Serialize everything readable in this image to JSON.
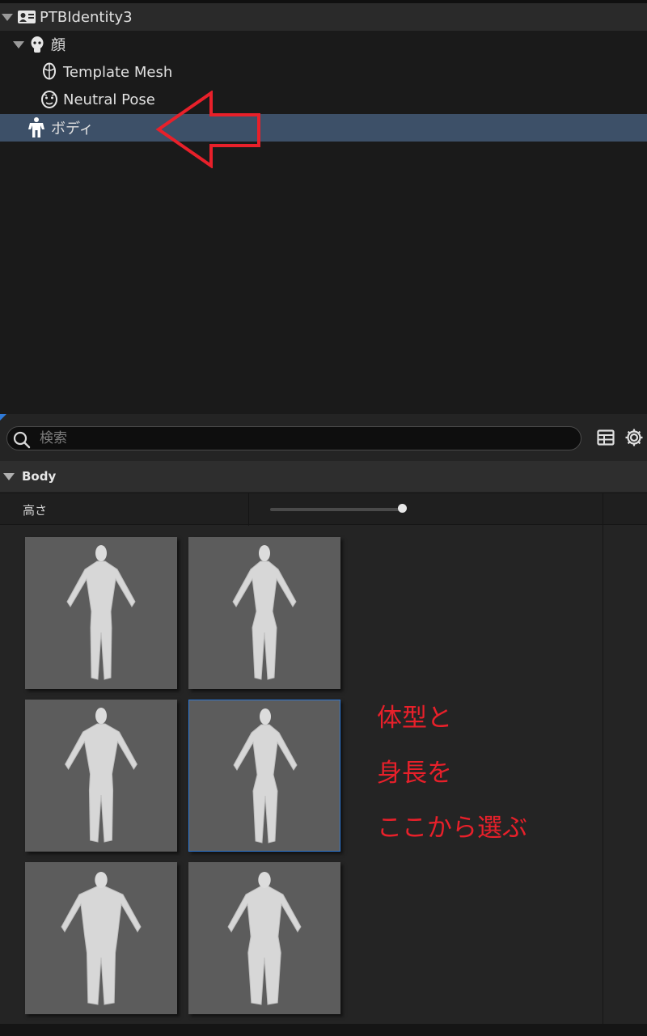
{
  "outliner": {
    "root": {
      "label": "PTBIdentity3",
      "icon": "identity-icon"
    },
    "face": {
      "label": "顔",
      "icon": "head-icon"
    },
    "template_mesh": {
      "label": "Template Mesh",
      "icon": "mesh-head-icon"
    },
    "neutral_pose": {
      "label": "Neutral Pose",
      "icon": "face-pose-icon"
    },
    "body": {
      "label": "ボディ",
      "icon": "body-icon",
      "selected": true
    }
  },
  "details": {
    "search": {
      "placeholder": "検索",
      "value": ""
    },
    "category": {
      "label": "Body"
    },
    "property": {
      "label": "高さ",
      "slider_value": 1.0
    },
    "presets": [
      {
        "body_type": "male-average",
        "selected": false
      },
      {
        "body_type": "female-average",
        "selected": false
      },
      {
        "body_type": "male-muscular",
        "selected": false
      },
      {
        "body_type": "female-curvy",
        "selected": true
      },
      {
        "body_type": "male-heavy",
        "selected": false
      },
      {
        "body_type": "female-heavy",
        "selected": false
      }
    ]
  },
  "annotation": {
    "lines": [
      "体型と",
      "身長を",
      "ここから選ぶ"
    ],
    "color": "#e8202a"
  },
  "colors": {
    "selection": "#3d5068",
    "accent": "#2f7ad8"
  }
}
